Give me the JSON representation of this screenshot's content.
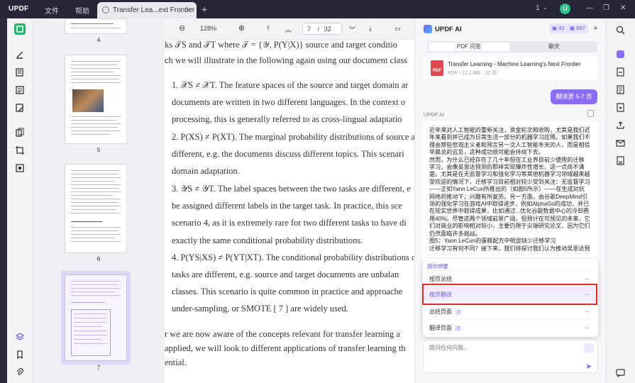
{
  "app": {
    "logo": "UPDF",
    "menu": [
      "文件",
      "帮助"
    ],
    "tab_title": "Transfer Lea...ext Frontier",
    "page_count_indicator": "1",
    "avatar_letter": "U"
  },
  "thumbnails": {
    "labels": [
      "4",
      "5",
      "6",
      "7"
    ]
  },
  "toolbar": {
    "zoom": "128%",
    "current_page": "7",
    "page_separator": "/",
    "total_pages": "32"
  },
  "document": {
    "lines": [
      "ks 𝒯S and 𝒯T where 𝒯 = {𝒴, P(Y|X)} source and target conditio",
      "ch we will illustrate in the following again using our document class",
      "1. 𝒳S ≠ 𝒳T. The feature spaces of the source and target domain ar",
      "documents are written in two different languages. In the context o",
      "processing, this is generally referred to as cross-lingual adaptatio",
      "2. P(XS) ≠ P(XT). The marginal probability distributions of source a",
      "different, e.g. the documents discuss different topics. This scenari",
      "domain adaptation.",
      "3. 𝒴S ≠ 𝒴T. The label spaces between the two tasks are different, e",
      "be assigned different labels in the target task. In practice, this sce",
      "scenario 4, as it is extremely rare for two different tasks to have di",
      "exactly the same conditional probability distributions.",
      "4. P(YS|XS) ≠ P(YT|XT). The conditional probability distributions o",
      "tasks are different, e.g. source and target documents are unbalan",
      "classes. This scenario is quite common in practice and approache",
      "under-sampling, or SMOTE [ 7 ] are widely used.",
      "r we are now aware of the concepts relevant for transfer learning a",
      "applied, we will look to different applications of transfer learning th",
      "ential."
    ]
  },
  "ai_panel": {
    "title": "UPDF AI",
    "badge_a": "92",
    "badge_b": "887",
    "tab_pdf": "PDF 问答",
    "tab_chat": "聊天",
    "file_name": "Transfer Learning - Machine Learning's Next Frontier",
    "file_meta": "PDF - 12.1 MB · 32 页",
    "pdf_icon_label": "PDF",
    "user_message": "翻译第 5-7 页",
    "ai_label": "UPDF AI",
    "answer_lines": [
      "近年来对人工智能的重新关注，资金轮次和收购，尤其是我们近",
      "年来看到并已成为日常生活一部分的机器学习应用。如果我们不",
      "理会那些悲观主义者和预言另一次人工智能冬天的人，而是相信",
      "早晨总的远见，这种成功很可能会持续下去。",
      "然而，为什么已经存在了几十年但在工业界目前少使用的迁移",
      "学习，会像吴恩达预测的那样实现爆炸性增长，这一点尚不清",
      "楚。尤其是在无监督学习和强化学习等其他机器学习领域越来越",
      "受欢迎的情况下，迁移学习目前相对较少受到关注：无监督学习",
      "——正如Yann LeCun所推出的（如图5所示）——在生成对抗",
      "网络的推动下，兴趣有所复苏。另一方面，由谷歌DeepMind引",
      "领的强化学习在游戏AI中取得进步，例如AlphaGo的成功，并已",
      "在现实世界中取得成果，比如通过...优化谷歌数据中心的冷却费",
      "用40%。尽管这两个领域前景广阔，但预计在可预见的未来，它",
      "们对商业的影响相对较小，主要仍限于尖端研究论文，因为它们",
      "仍然面临许多挑战。",
      "图5：Yann LeCun的蛋糕配方中明显缺少迁移学习",
      "迁移学习有何不同？接下来，我们将探讨我们认为推动吴恩达预"
    ],
    "suggest_header": "猜你想要",
    "suggestions": [
      {
        "label": "按页总结",
        "num": ""
      },
      {
        "label": "按页翻译",
        "num": ""
      },
      {
        "label": "总结页面",
        "num": "7"
      },
      {
        "label": "翻译页面",
        "num": "7"
      }
    ],
    "input_placeholder": "提问任何问题..."
  },
  "colors": {
    "accent": "#8b6cf6",
    "highlight_box": "#e02b2b",
    "titlebar": "#262637"
  }
}
